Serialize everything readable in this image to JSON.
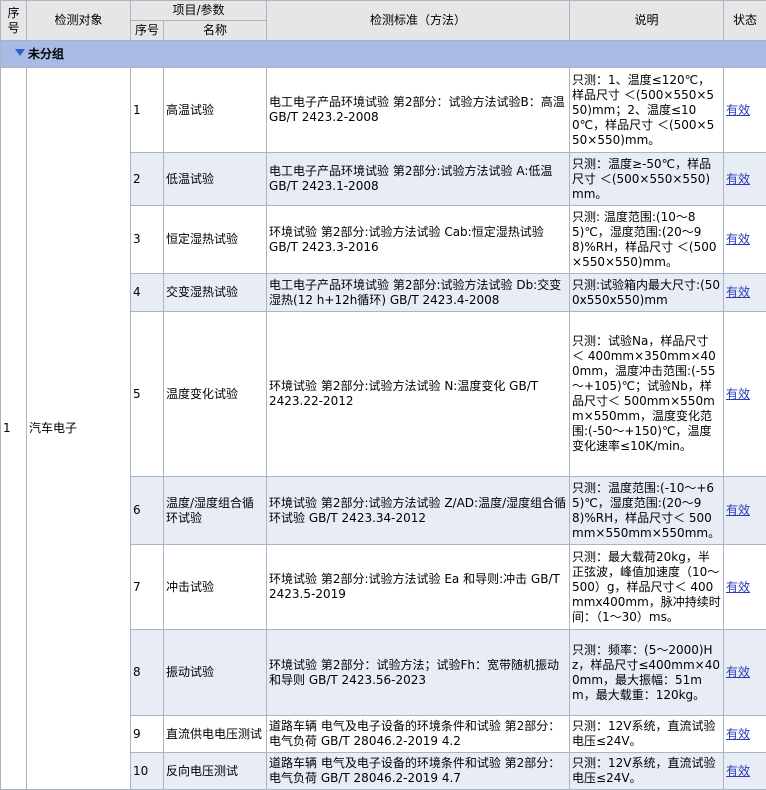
{
  "header": {
    "seq": "序号",
    "object": "检测对象",
    "item_param": "项目/参数",
    "sub_seq": "序号",
    "sub_name": "名称",
    "standard": "检测标准（方法）",
    "note": "说明",
    "status": "状态"
  },
  "group_label": "未分组",
  "main_row": {
    "seq": "1",
    "object": "汽车电子"
  },
  "rows": [
    {
      "no": "1",
      "name": "高温试验",
      "standard": "电工电子产品环境试验 第2部分：试验方法试验B：高温 GB/T 2423.2-2008",
      "note": "只测：1、温度≤120℃，样品尺寸 ＜(500×550×550)mm；2、温度≤100℃，样品尺寸 ＜(500×550×550)mm。",
      "status": "有效"
    },
    {
      "no": "2",
      "name": "低温试验",
      "standard": "电工电子产品环境试验 第2部分:试验方法试验 A:低温 GB/T 2423.1-2008",
      "note": "只测：温度≥-50℃，样品尺寸 ＜(500×550×550)mm。",
      "status": "有效"
    },
    {
      "no": "3",
      "name": "恒定湿热试验",
      "standard": "环境试验 第2部分:试验方法试验 Cab:恒定湿热试验 GB/T 2423.3-2016",
      "note": "只测: 温度范围:(10～85)℃，湿度范围:(20～98)%RH，样品尺寸 ＜(500×550×550)mm。",
      "status": "有效"
    },
    {
      "no": "4",
      "name": "交变湿热试验",
      "standard": "电工电子产品环境试验 第2部分:试验方法试验 Db:交变湿热(12 h+12h循环) GB/T 2423.4-2008",
      "note": "只测:试验箱内最大尺寸:(500x550x550)mm",
      "status": "有效"
    },
    {
      "no": "5",
      "name": "温度变化试验",
      "standard": "环境试验 第2部分:试验方法试验 N:温度变化 GB/T 2423.22-2012",
      "note": "只测：试验Na，样品尺寸 ＜ 400mm×350mm×400mm，温度冲击范围:(-55～+105)℃；试验Nb，样品尺寸＜ 500mm×550mm×550mm，温度变化范围:(-50～+150)℃，温度变化速率≤10K/min。",
      "status": "有效"
    },
    {
      "no": "6",
      "name": "温度/湿度组合循环试验",
      "standard": "环境试验 第2部分:试验方法试验 Z/AD:温度/湿度组合循环试验 GB/T 2423.34-2012",
      "note": "只测：温度范围:(-10～+65)℃，湿度范围:(20～98)%RH，样品尺寸＜ 500mm×550mm×550mm。",
      "status": "有效"
    },
    {
      "no": "7",
      "name": "冲击试验",
      "standard": "环境试验 第2部分:试验方法试验 Ea 和导则:冲击 GB/T 2423.5-2019",
      "note": "只测：最大载荷20kg，半正弦波，峰值加速度（10～500）g，样品尺寸＜ 400mmx400mm，脉冲持续时间：（1～30）ms。",
      "status": "有效"
    },
    {
      "no": "8",
      "name": "振动试验",
      "standard": "环境试验 第2部分：试验方法；试验Fh：宽带随机振动和导则 GB/T 2423.56-2023",
      "note": "只测：频率：(5～2000)Hz，样品尺寸≤400mm×400mm，最大振幅：51mm，最大载重：120kg。",
      "status": "有效"
    },
    {
      "no": "9",
      "name": "直流供电电压测试",
      "standard": "道路车辆 电气及电子设备的环境条件和试验 第2部分：电气负荷 GB/T 28046.2-2019 4.2",
      "note": "只测：12V系统，直流试验电压≤24V。",
      "status": "有效"
    },
    {
      "no": "10",
      "name": "反向电压测试",
      "standard": "道路车辆 电气及电子设备的环境条件和试验 第2部分：电气负荷 GB/T 28046.2-2019 4.7",
      "note": "只测：12V系统，直流试验电压≤24V。",
      "status": "有效"
    }
  ]
}
